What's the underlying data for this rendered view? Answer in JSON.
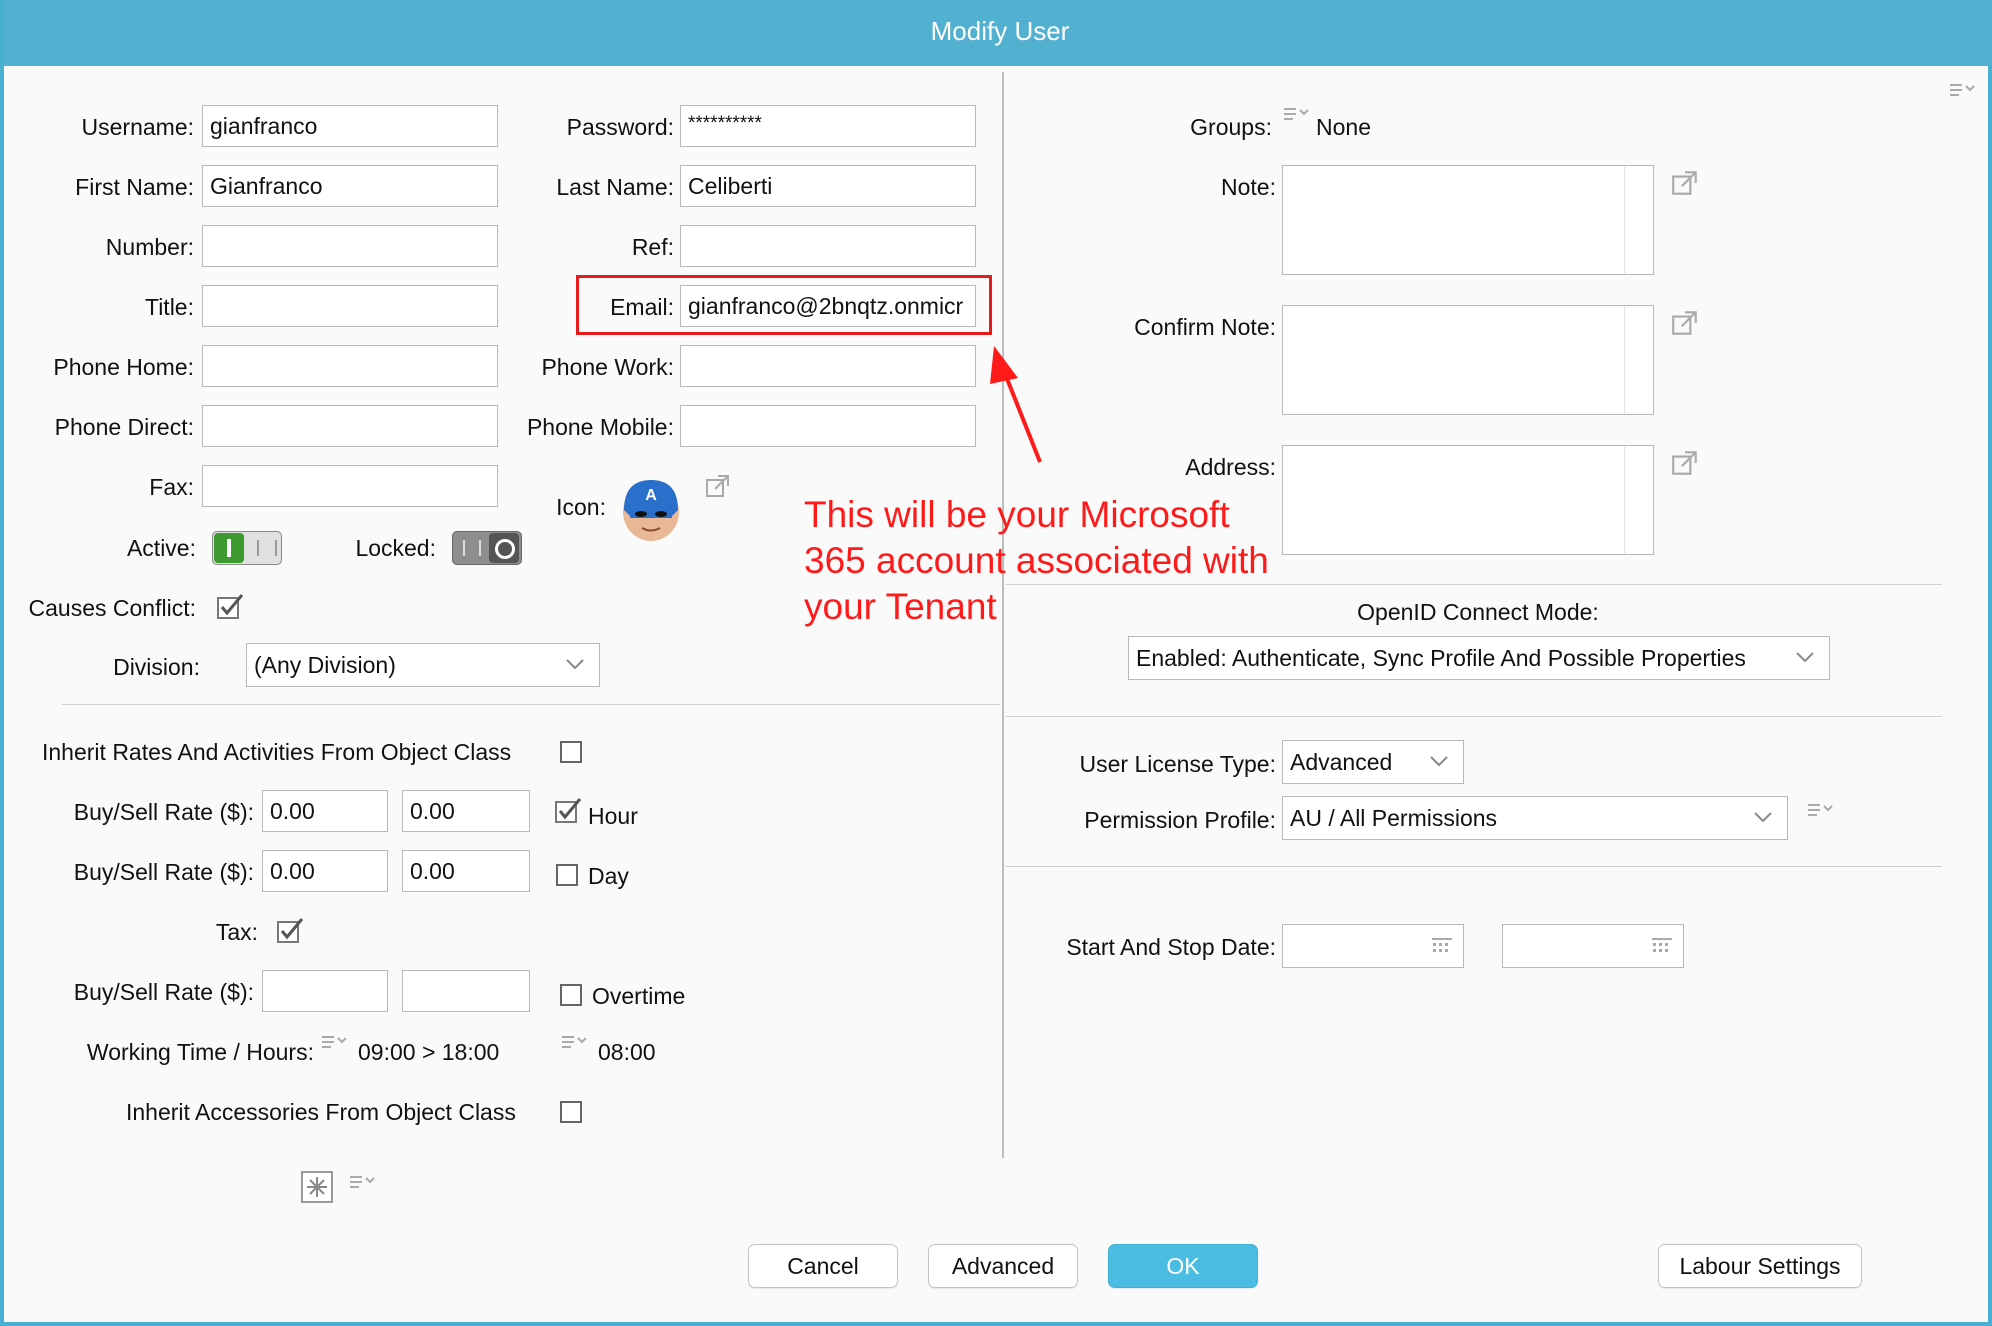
{
  "window": {
    "title": "Modify User"
  },
  "left": {
    "username_label": "Username:",
    "username_value": "gianfranco",
    "password_label": "Password:",
    "password_value": "**********",
    "firstname_label": "First Name:",
    "firstname_value": "Gianfranco",
    "lastname_label": "Last Name:",
    "lastname_value": "Celiberti",
    "number_label": "Number:",
    "number_value": "",
    "ref_label": "Ref:",
    "ref_value": "",
    "title_label": "Title:",
    "title_value": "",
    "email_label": "Email:",
    "email_value": "gianfranco@2bnqtz.onmicr",
    "phone_home_label": "Phone Home:",
    "phone_home_value": "",
    "phone_work_label": "Phone Work:",
    "phone_work_value": "",
    "phone_direct_label": "Phone Direct:",
    "phone_direct_value": "",
    "phone_mobile_label": "Phone Mobile:",
    "phone_mobile_value": "",
    "fax_label": "Fax:",
    "fax_value": "",
    "icon_label": "Icon:",
    "active_label": "Active:",
    "active_on": true,
    "locked_label": "Locked:",
    "locked_on": false,
    "causes_conflict_label": "Causes Conflict:",
    "causes_conflict_checked": true,
    "division_label": "Division:",
    "division_value": "(Any Division)",
    "inherit_rates_label": "Inherit Rates And Activities From Object Class",
    "inherit_rates_checked": false,
    "rate_label": "Buy/Sell Rate ($):",
    "rate_hour_buy": "0.00",
    "rate_hour_sell": "0.00",
    "hour_label": "Hour",
    "hour_checked": true,
    "rate_day_buy": "0.00",
    "rate_day_sell": "0.00",
    "day_label": "Day",
    "day_checked": false,
    "tax_label": "Tax:",
    "tax_checked": true,
    "rate_ot_buy": "",
    "rate_ot_sell": "",
    "overtime_label": "Overtime",
    "overtime_checked": false,
    "working_time_label": "Working Time / Hours:",
    "working_time_value": "09:00 > 18:00",
    "working_hours_value": "08:00",
    "inherit_accessories_label": "Inherit Accessories From Object Class",
    "inherit_accessories_checked": false
  },
  "right": {
    "groups_label": "Groups:",
    "groups_value": "None",
    "note_label": "Note:",
    "confirm_note_label": "Confirm Note:",
    "address_label": "Address:",
    "openid_label": "OpenID Connect Mode:",
    "openid_value": "Enabled: Authenticate, Sync Profile And Possible Properties",
    "license_label": "User License Type:",
    "license_value": "Advanced",
    "permission_label": "Permission Profile:",
    "permission_value": "AU / All Permissions",
    "dates_label": "Start And Stop Date:",
    "start_date": "",
    "stop_date": ""
  },
  "annotation": {
    "line1": "This will be your Microsoft",
    "line2": "365 account associated with",
    "line3": "your Tenant",
    "color": "#ff1a1a"
  },
  "buttons": {
    "cancel": "Cancel",
    "advanced": "Advanced",
    "ok": "OK",
    "labour": "Labour Settings"
  },
  "colors": {
    "titlebar": "#52b0d0",
    "ok_button": "#4bbde3",
    "toggle_on": "#3d9a2e",
    "annotation": "#ff1a1a"
  }
}
